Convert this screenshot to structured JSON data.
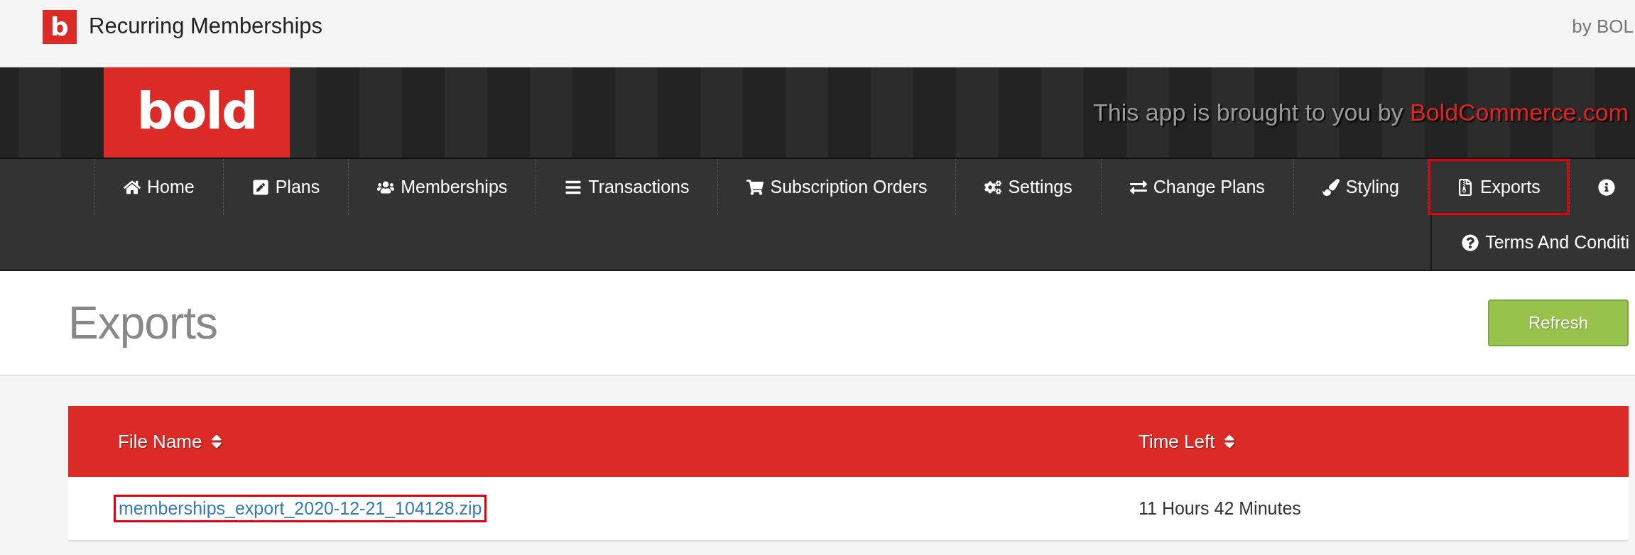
{
  "app_bar": {
    "logo_letter": "b",
    "title": "Recurring Memberships",
    "vendor": "by BOL"
  },
  "banner": {
    "logo_text": "bold",
    "tagline": "This app is brought to you by",
    "tagline_link": "BoldCommerce.com"
  },
  "nav": {
    "items": [
      {
        "label": "Home",
        "highlighted": false
      },
      {
        "label": "Plans",
        "highlighted": false
      },
      {
        "label": "Memberships",
        "highlighted": false
      },
      {
        "label": "Transactions",
        "highlighted": false
      },
      {
        "label": "Subscription Orders",
        "highlighted": false
      },
      {
        "label": "Settings",
        "highlighted": false
      },
      {
        "label": "Change Plans",
        "highlighted": false
      },
      {
        "label": "Styling",
        "highlighted": false
      },
      {
        "label": "Exports",
        "highlighted": true
      },
      {
        "highlighted": false
      }
    ],
    "second_row": [
      {
        "label": "Terms And Conditi",
        "highlighted": false
      }
    ]
  },
  "page": {
    "title": "Exports",
    "refresh_button": "Refresh"
  },
  "table": {
    "columns": [
      "File Name",
      "Time Left"
    ],
    "rows": [
      {
        "file_name": "memberships_export_2020-12-21_104128.zip",
        "highlighted": true,
        "time_left": "11 Hours 42 Minutes"
      }
    ]
  }
}
